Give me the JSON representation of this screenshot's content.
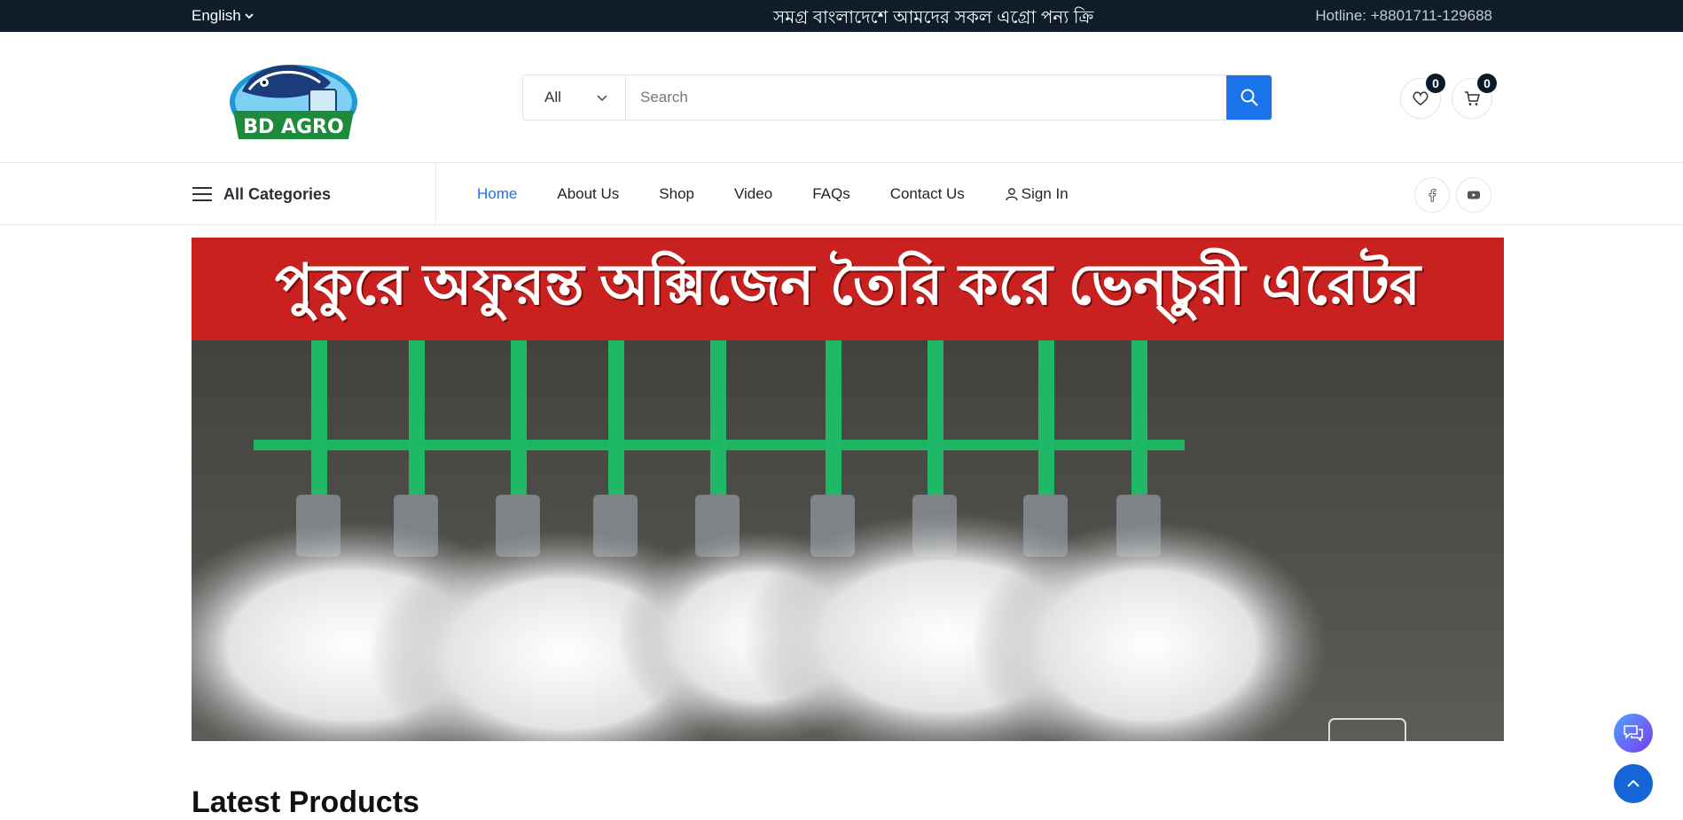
{
  "topbar": {
    "language": "English",
    "marquee": "সমগ্র বাংলাদেশে আমদের সকল এগ্রো পন্য ক্রি",
    "hotline": "Hotline: +8801711-129688"
  },
  "header": {
    "logo_text": "BD AGRO",
    "search": {
      "category": "All",
      "placeholder": "Search"
    },
    "wishlist_count": "0",
    "cart_count": "0"
  },
  "nav": {
    "all_categories": "All Categories",
    "items": [
      {
        "label": "Home",
        "active": true
      },
      {
        "label": "About Us"
      },
      {
        "label": "Shop"
      },
      {
        "label": "Video"
      },
      {
        "label": "FAQs"
      },
      {
        "label": "Contact Us"
      },
      {
        "label": "Sign In"
      }
    ]
  },
  "banner": {
    "headline": "পুকুরে অফুরন্ত অক্সিজেন তৈরি করে ভেন্চুরী এরেটর"
  },
  "section": {
    "title": "Latest Products"
  },
  "colors": {
    "topbar": "#0f1d2b",
    "accent": "#1a73e8",
    "banner_strip": "#c8211f"
  },
  "icons": [
    "chevron-down-icon",
    "search-icon",
    "heart-icon",
    "cart-icon",
    "menu-icon",
    "user-icon",
    "facebook-icon",
    "youtube-icon",
    "chat-icon",
    "arrow-up-icon"
  ]
}
